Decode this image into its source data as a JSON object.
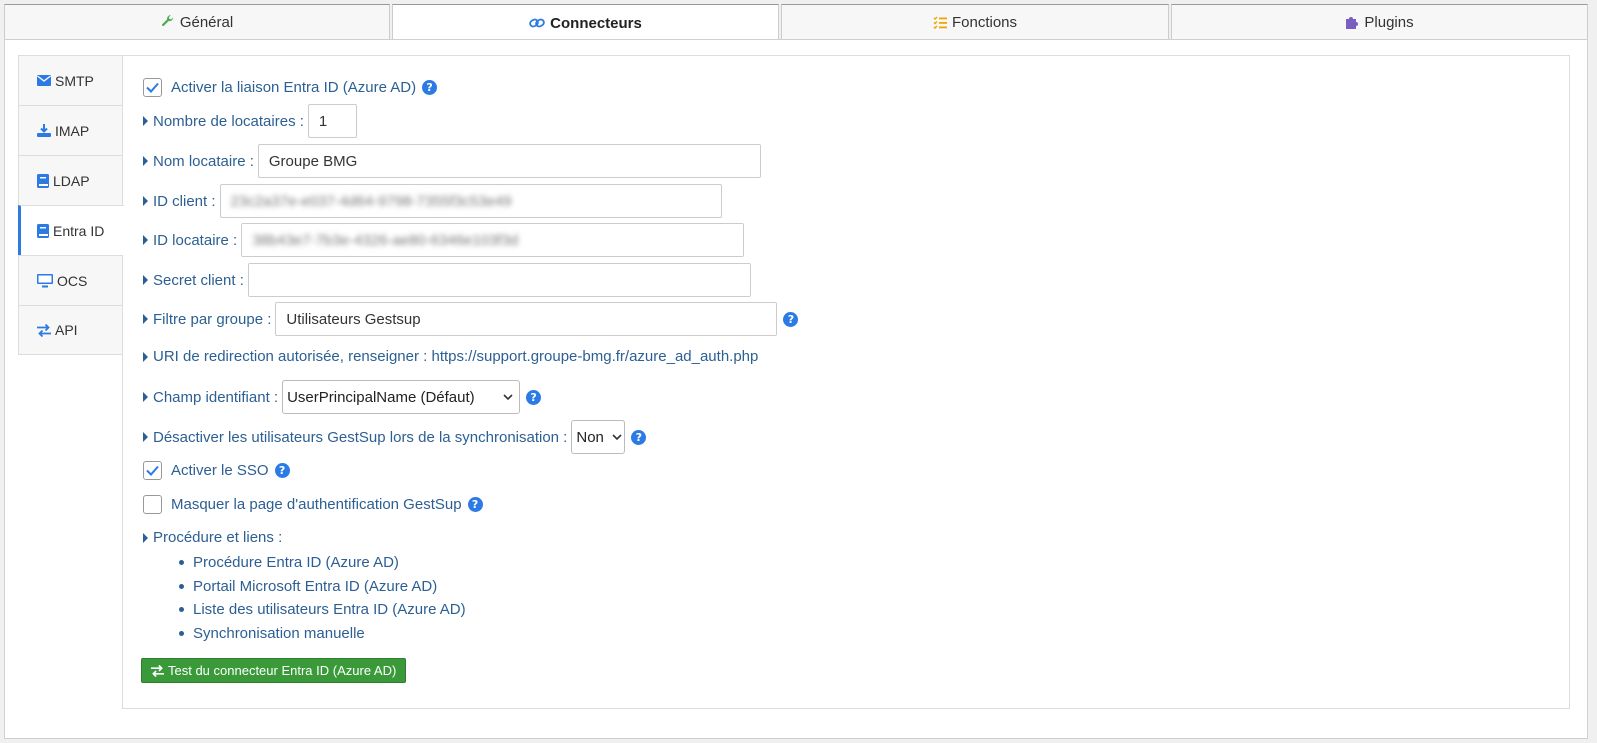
{
  "top_tabs": [
    {
      "label": "Général",
      "icon": "wrench-icon",
      "color": "#4caf50"
    },
    {
      "label": "Connecteurs",
      "icon": "link-icon",
      "color": "#2c7be5",
      "active": true
    },
    {
      "label": "Fonctions",
      "icon": "list-check-icon",
      "color": "#f0a500"
    },
    {
      "label": "Plugins",
      "icon": "puzzle-icon",
      "color": "#7a5fc0"
    }
  ],
  "side_tabs": [
    {
      "label": "SMTP",
      "icon": "envelope-icon"
    },
    {
      "label": "IMAP",
      "icon": "download-icon"
    },
    {
      "label": "LDAP",
      "icon": "book-icon"
    },
    {
      "label": "Entra ID",
      "icon": "book-icon",
      "active": true
    },
    {
      "label": "OCS",
      "icon": "desktop-icon"
    },
    {
      "label": "API",
      "icon": "exchange-icon"
    }
  ],
  "form": {
    "enable_label": "Activer la liaison Entra ID (Azure AD)",
    "tenant_count_label": "Nombre de locataires :",
    "tenant_count_value": "1",
    "tenant_name_label": "Nom locataire :",
    "tenant_name_value": "Groupe BMG",
    "client_id_label": "ID client :",
    "client_id_value": "23c2a37e-e037-4d64-9798-7355f3c53e49",
    "tenant_id_label": "ID locataire :",
    "tenant_id_value": "38b43e7-7b3e-4326-ae80-6346e103f3d",
    "client_secret_label": "Secret client :",
    "client_secret_value": "",
    "group_filter_label": "Filtre par groupe :",
    "group_filter_value": "Utilisateurs Gestsup",
    "redirect_uri_text": "URI de redirection autorisée, renseigner : https://support.groupe-bmg.fr/azure_ad_auth.php",
    "id_field_label": "Champ identifiant :",
    "id_field_value": "UserPrincipalName (Défaut)",
    "disable_users_label": "Désactiver les utilisateurs GestSup lors de la synchronisation :",
    "disable_users_value": "Non",
    "sso_label": "Activer le SSO",
    "hide_auth_label": "Masquer la page d'authentification GestSup",
    "procedure_label": "Procédure et liens :",
    "links": [
      "Procédure Entra ID (Azure AD)",
      "Portail Microsoft Entra ID (Azure AD)",
      "Liste des utilisateurs Entra ID (Azure AD)",
      "Synchronisation manuelle"
    ],
    "test_button_label": "Test du connecteur Entra ID (Azure AD)"
  },
  "colors": {
    "link": "#2c5f93",
    "accent": "#2c7be5",
    "button": "#3a9a3a"
  }
}
